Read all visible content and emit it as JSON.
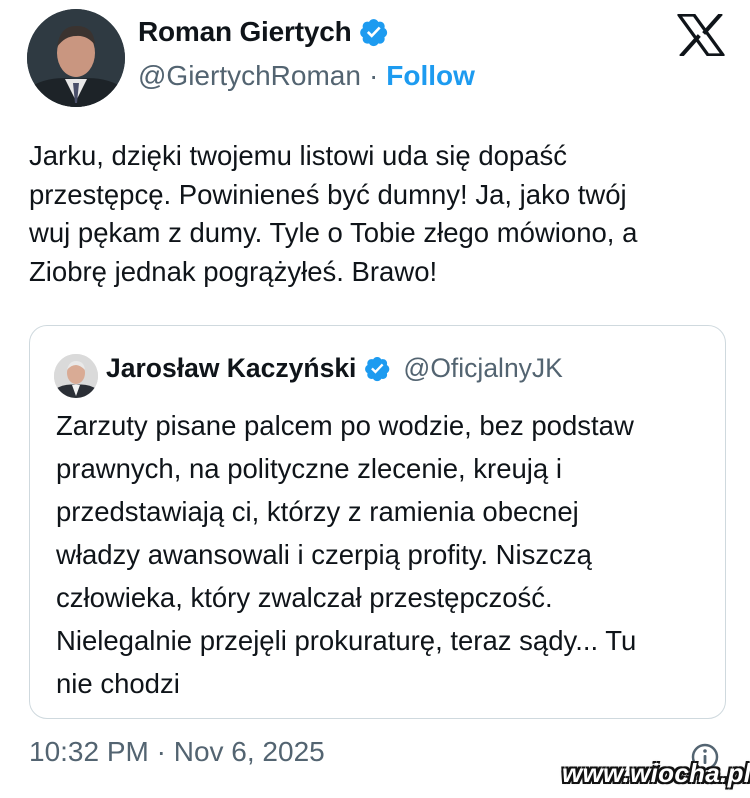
{
  "author": {
    "name": "Roman Giertych",
    "handle": "@GiertychRoman",
    "separator": "·",
    "follow_label": "Follow",
    "verified_color": "#1d9bf0"
  },
  "tweet": {
    "text": "Jarku, dzięki twojemu listowi uda się dopaść\nprzestępcę. Powinieneś być dumny! Ja, jako twój\nwuj pękam z dumy. Tyle o Tobie złego mówiono, a\nZiobrę jednak pogrążyłeś. Brawo!",
    "timestamp": "10:32 PM · Nov 6, 2025"
  },
  "quoted_tweet": {
    "name": "Jarosław Kaczyński",
    "handle": "@OficjalnyJK",
    "text": "Zarzuty pisane palcem po wodzie, bez podstaw\nprawnych, na polityczne zlecenie, kreują i\nprzedstawiają ci, którzy z ramienia obecnej\nwładzy awansowali i czerpią profity. Niszczą\nczłowieka, który zwalczał przestępczość.\nNielegalnie przejęli prokuraturę, teraz sądy... Tu\nnie chodzi"
  },
  "icons": {
    "platform": "x-logo-icon",
    "verified": "verified-badge-icon",
    "info": "info-icon"
  },
  "watermark": "www.wiocha.pl"
}
